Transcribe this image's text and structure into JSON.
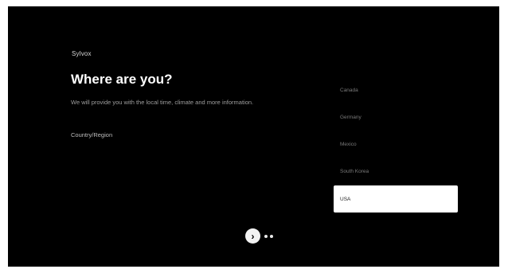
{
  "header": {
    "brand": "Sylvox"
  },
  "main": {
    "title": "Where are you?",
    "description": "We will provide you with the local time, climate and more information.",
    "region_label": "Country/Region"
  },
  "country_list": {
    "items": [
      {
        "label": "Canada",
        "selected": false
      },
      {
        "label": "Germany",
        "selected": false
      },
      {
        "label": "Mexico",
        "selected": false
      },
      {
        "label": "South Korea",
        "selected": false
      },
      {
        "label": "USA",
        "selected": true
      }
    ]
  },
  "navigation": {
    "next_glyph": "›",
    "page_dots": 2
  }
}
